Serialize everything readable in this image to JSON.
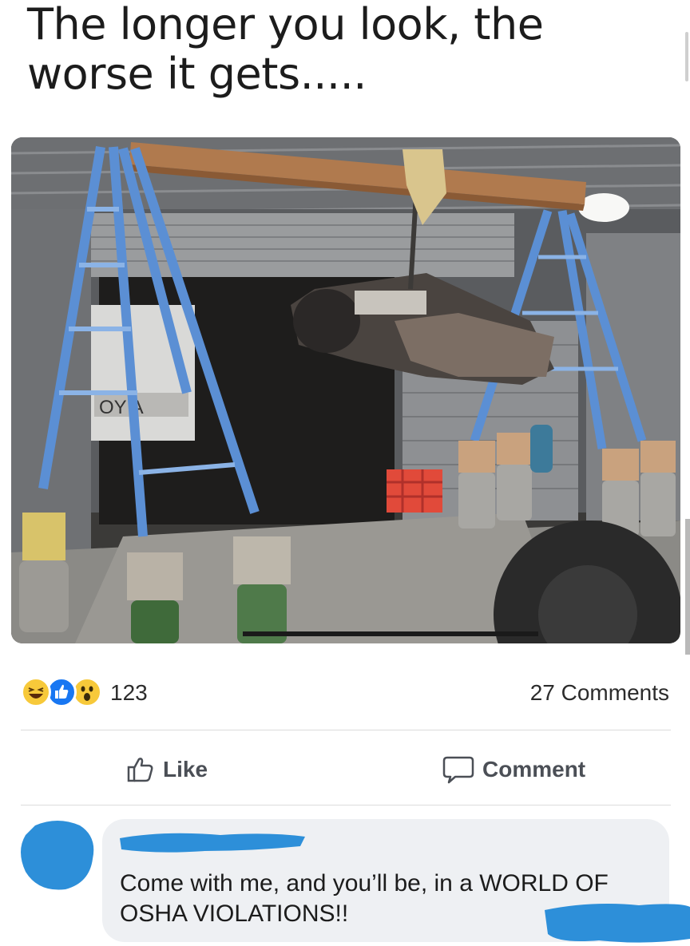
{
  "meme": {
    "caption": "The longer you look, the worse it gets....."
  },
  "post": {
    "photo_alt": "engine-hoist-photo",
    "sign_text": "OY   A"
  },
  "reactions": {
    "icons": [
      "haha-reaction-icon",
      "like-reaction-icon",
      "wow-reaction-icon"
    ],
    "count": "123",
    "comments": "27 Comments"
  },
  "actions": {
    "like_label": "Like",
    "comment_label": "Comment"
  },
  "comment": {
    "text": "Come with me, and you’ll be, in a WORLD OF OSHA VIOLATIONS!!"
  },
  "colors": {
    "like_blue": "#1877f2",
    "redaction_blue": "#2d8fd9",
    "bubble_gray": "#eef0f3"
  }
}
